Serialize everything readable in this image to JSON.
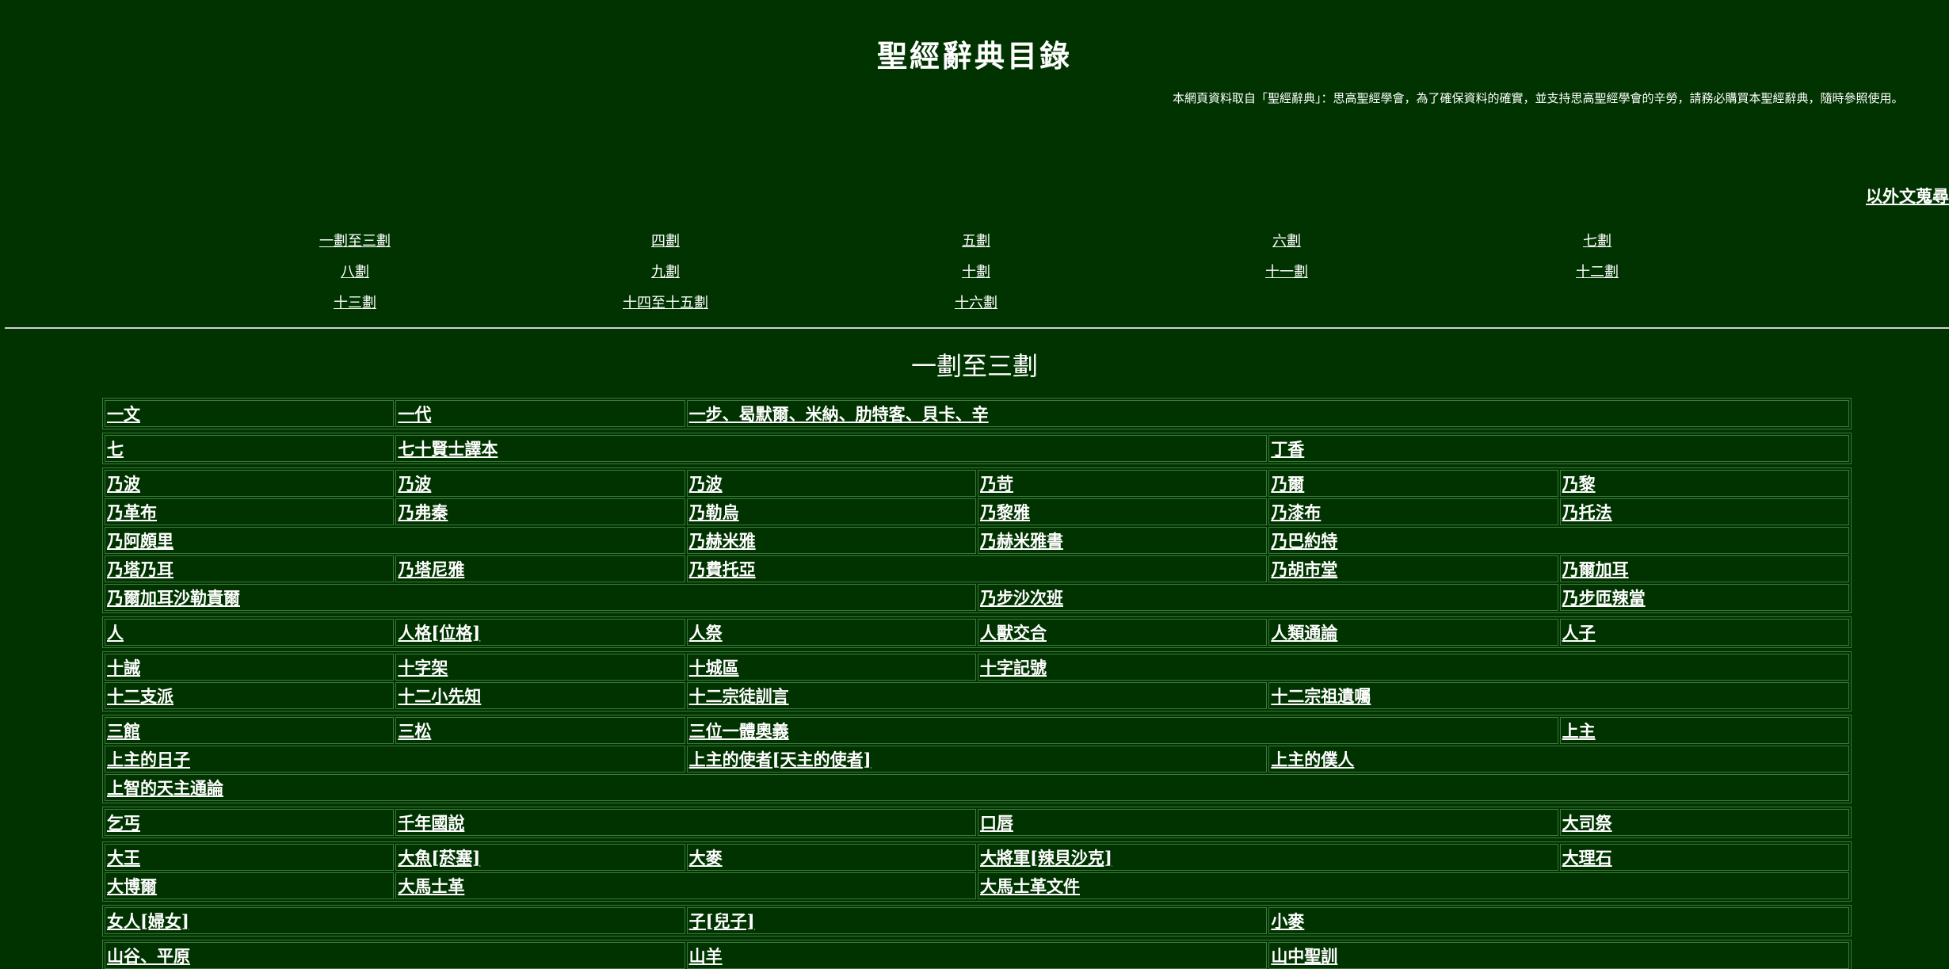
{
  "header": {
    "title": "聖經辭典目錄",
    "notice": "本網頁資料取自「聖經辭典」：思高聖經學會，為了確保資料的確實，並支持思高聖經學會的辛勞，請務必購買本聖經辭典，隨時參照使用。",
    "foreign_search_link": "以外文蒐尋"
  },
  "stroke_nav": [
    "一劃至三劃",
    "四劃",
    "五劃",
    "六劃",
    "七劃",
    "八劃",
    "九劃",
    "十劃",
    "十一劃",
    "十二劃",
    "十三劃",
    "十四至十五劃",
    "十六劃"
  ],
  "section_heading": "一劃至三劃",
  "entry_groups": [
    [
      [
        {
          "t": "一文",
          "s": 1
        },
        {
          "t": "一代",
          "s": 1
        },
        {
          "t": "一步、曷默爾、米納、肋特客、貝卡、辛",
          "s": 4
        }
      ]
    ],
    [
      [
        {
          "t": "七",
          "s": 1
        },
        {
          "t": "七十賢士譯本",
          "s": 3
        },
        {
          "t": "丁香",
          "s": 2
        }
      ]
    ],
    [
      [
        {
          "t": "乃波",
          "s": 1
        },
        {
          "t": "乃波",
          "s": 1
        },
        {
          "t": "乃波",
          "s": 1
        },
        {
          "t": "乃苛",
          "s": 1
        },
        {
          "t": "乃爾",
          "s": 1
        },
        {
          "t": "乃黎",
          "s": 1
        }
      ],
      [
        {
          "t": "乃革布",
          "s": 1
        },
        {
          "t": "乃弗秦",
          "s": 1
        },
        {
          "t": "乃勒烏",
          "s": 1
        },
        {
          "t": "乃黎雅",
          "s": 1
        },
        {
          "t": "乃漆布",
          "s": 1
        },
        {
          "t": "乃托法",
          "s": 1
        }
      ],
      [
        {
          "t": "乃阿頗里",
          "s": 2
        },
        {
          "t": "乃赫米雅",
          "s": 1
        },
        {
          "t": "乃赫米雅書",
          "s": 1
        },
        {
          "t": "乃巴約特",
          "s": 2
        }
      ],
      [
        {
          "t": "乃塔乃耳",
          "s": 1
        },
        {
          "t": "乃塔尼雅",
          "s": 1
        },
        {
          "t": "乃費托亞",
          "s": 2
        },
        {
          "t": "乃胡市堂",
          "s": 1
        },
        {
          "t": "乃爾加耳",
          "s": 1
        }
      ],
      [
        {
          "t": "乃爾加耳沙勒責爾",
          "s": 3
        },
        {
          "t": "乃步沙次班",
          "s": 2
        },
        {
          "t": "乃步匝辣當",
          "s": 1
        }
      ]
    ],
    [
      [
        {
          "t": "人",
          "s": 1
        },
        {
          "t": "人格[位格]",
          "s": 1
        },
        {
          "t": "人祭",
          "s": 1
        },
        {
          "t": "人獸交合",
          "s": 1
        },
        {
          "t": "人類通論",
          "s": 1
        },
        {
          "t": "人子",
          "s": 1
        }
      ]
    ],
    [
      [
        {
          "t": "十誡",
          "s": 1
        },
        {
          "t": "十字架",
          "s": 1
        },
        {
          "t": "十城區",
          "s": 1
        },
        {
          "t": "十字記號",
          "s": 3
        }
      ],
      [
        {
          "t": "十二支派",
          "s": 1
        },
        {
          "t": "十二小先知",
          "s": 1
        },
        {
          "t": "十二宗徒訓言",
          "s": 2
        },
        {
          "t": "十二宗祖遺囑",
          "s": 2
        }
      ]
    ],
    [
      [
        {
          "t": "三館",
          "s": 1
        },
        {
          "t": "三松",
          "s": 1
        },
        {
          "t": "三位一體奧義",
          "s": 3
        },
        {
          "t": "上主",
          "s": 1
        }
      ],
      [
        {
          "t": "上主的日子",
          "s": 2
        },
        {
          "t": "上主的使者[天主的使者]",
          "s": 2
        },
        {
          "t": "上主的僕人",
          "s": 2
        }
      ],
      [
        {
          "t": "上智的天主通論",
          "s": 6
        }
      ]
    ],
    [
      [
        {
          "t": "乞丐",
          "s": 1
        },
        {
          "t": "千年國說",
          "s": 2
        },
        {
          "t": "口唇",
          "s": 2
        },
        {
          "t": "大司祭",
          "s": 1
        }
      ]
    ],
    [
      [
        {
          "t": "大王",
          "s": 1
        },
        {
          "t": "大魚[菸塞]",
          "s": 1
        },
        {
          "t": "大麥",
          "s": 1
        },
        {
          "t": "大將軍[辣貝沙克]",
          "s": 2
        },
        {
          "t": "大理石",
          "s": 1
        }
      ],
      [
        {
          "t": "大博爾",
          "s": 1
        },
        {
          "t": "大馬士革",
          "s": 2
        },
        {
          "t": "大馬士革文件",
          "s": 3
        }
      ]
    ],
    [
      [
        {
          "t": "女人[婦女]",
          "s": 2
        },
        {
          "t": "子[兒子]",
          "s": 2
        },
        {
          "t": "小麥",
          "s": 2
        }
      ]
    ],
    [
      [
        {
          "t": "山谷、平原",
          "s": 2
        },
        {
          "t": "山羊",
          "s": 2
        },
        {
          "t": "山中聖訓",
          "s": 2
        }
      ]
    ]
  ]
}
